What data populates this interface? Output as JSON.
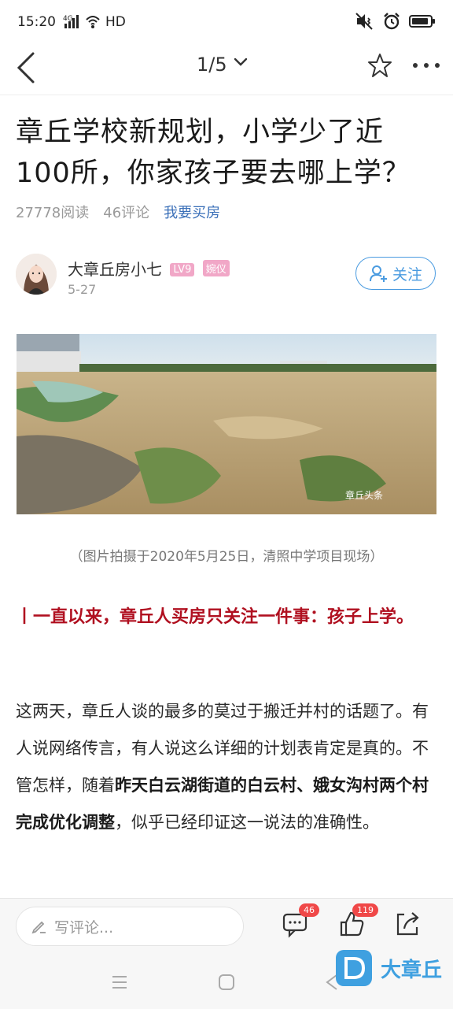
{
  "status_bar": {
    "time": "15:20",
    "network": "4G",
    "hd": "HD"
  },
  "header": {
    "page_indicator": "1/5"
  },
  "article": {
    "title": "章丘学校新规划，小学少了近100所，你家孩子要去哪上学？",
    "reads": "27778阅读",
    "comments": "46评论",
    "buy_link": "我要买房",
    "author": {
      "name": "大章丘房小七",
      "level_badge": "LV9",
      "title_badge": "婉仪",
      "date": "5-27",
      "follow_label": "关注"
    },
    "photo_watermark": "章丘头条",
    "photo_caption": "（图片拍摄于2020年5月25日，清照中学项目现场）",
    "highlight": "丨一直以来，章丘人买房只关注一件事：孩子上学。",
    "body": {
      "part1": "这两天，章丘人谈的最多的莫过于搬迁并村的话题了。有人说网络传言，有人说这么详细的计划表肯定是真的。不管怎样，随着",
      "bold": "昨天白云湖街道的白云村、娥女沟村两个村完成优化调整",
      "part2": "，似乎已经印证这一说法的准确性。"
    }
  },
  "bottom_bar": {
    "comment_placeholder": "写评论...",
    "comment_count": "46",
    "like_count": "119"
  },
  "watermark": {
    "text": "大章丘"
  },
  "colors": {
    "accent_blue": "#4a9be0",
    "link_blue": "#3a6fb8",
    "highlight_red": "#b01020",
    "badge_red": "#f04848"
  }
}
